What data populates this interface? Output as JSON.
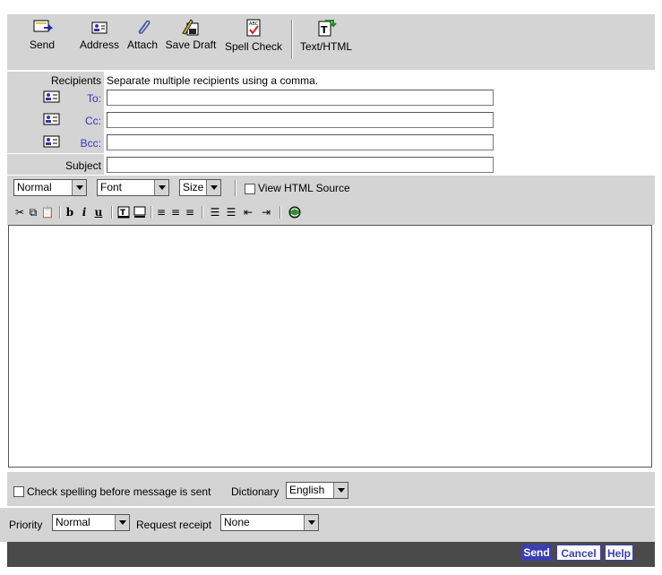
{
  "toolbar": {
    "send": "Send",
    "address": "Address",
    "attach": "Attach",
    "save_draft": "Save Draft",
    "spell_check": "Spell Check",
    "text_html": "Text/HTML"
  },
  "header": {
    "recipients_label": "Recipients",
    "recipients_hint": "Separate multiple recipients using a comma.",
    "to_label": "To:",
    "cc_label": "Cc:",
    "bcc_label": "Bcc:",
    "subject_label": "Subject",
    "to_value": "",
    "cc_value": "",
    "bcc_value": "",
    "subject_value": ""
  },
  "format_bar": {
    "paragraph_style": "Normal",
    "font": "Font",
    "size": "Size",
    "view_html_source": "View HTML Source",
    "icons": [
      "cut-icon",
      "copy-icon",
      "paste-icon",
      "bold-icon",
      "italic-icon",
      "underline-icon",
      "text-color-icon",
      "background-color-icon",
      "align-left-icon",
      "align-center-icon",
      "align-right-icon",
      "ordered-list-icon",
      "unordered-list-icon",
      "outdent-icon",
      "indent-icon",
      "insert-link-icon"
    ]
  },
  "body_text": "",
  "spellcheck": {
    "label": "Check spelling before message is sent",
    "dictionary_label": "Dictionary",
    "dictionary_value": "English"
  },
  "options": {
    "priority_label": "Priority",
    "priority_value": "Normal",
    "receipt_label": "Request receipt",
    "receipt_value": "None"
  },
  "footer": {
    "send": "Send",
    "cancel": "Cancel",
    "help": "Help"
  },
  "colors": {
    "panel": "#d4d4d4",
    "footer": "#4a4a4a",
    "accent": "#3a3fb5",
    "label_blue": "#3333cc"
  }
}
